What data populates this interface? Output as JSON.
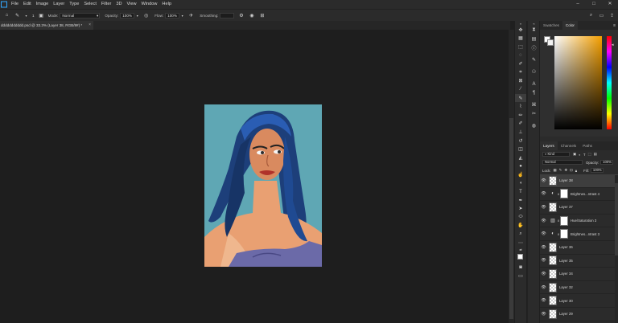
{
  "menu": [
    "File",
    "Edit",
    "Image",
    "Layer",
    "Type",
    "Select",
    "Filter",
    "3D",
    "View",
    "Window",
    "Help"
  ],
  "options": {
    "brush_size": "1",
    "mode_label": "Mode:",
    "mode_value": "Normal",
    "opacity_label": "Opacity:",
    "opacity_value": "100%",
    "flow_label": "Flow:",
    "flow_value": "100%",
    "smoothing_label": "Smoothing:"
  },
  "document_tab": {
    "title": "ddddddddddd.psd @ 33.3% (Layer 38, RGB/8#) *",
    "close": "×"
  },
  "panels": {
    "top_tabs": [
      "Swatches",
      "Color"
    ],
    "layer_tabs": [
      "Layers",
      "Channels",
      "Paths"
    ],
    "kind_label": "Kind",
    "blend_mode": "Normal",
    "opacity_label": "Opacity:",
    "opacity_value": "100%",
    "lock_label": "Lock:",
    "fill_label": "Fill:",
    "fill_value": "100%"
  },
  "layers": [
    {
      "name": "Layer 38",
      "type": "pixel",
      "selected": true
    },
    {
      "name": "Brightnes...ntrast 4",
      "type": "brightness",
      "selected": false
    },
    {
      "name": "Layer 37",
      "type": "pixel",
      "selected": false
    },
    {
      "name": "Hue/Saturation 3",
      "type": "hue",
      "selected": false
    },
    {
      "name": "Brightnes...ntrast 3",
      "type": "brightness",
      "selected": false
    },
    {
      "name": "Layer 36",
      "type": "pixel",
      "selected": false
    },
    {
      "name": "Layer 35",
      "type": "pixel",
      "selected": false
    },
    {
      "name": "Layer 34",
      "type": "pixel",
      "selected": false
    },
    {
      "name": "Layer 32",
      "type": "pixel",
      "selected": false
    },
    {
      "name": "Layer 30",
      "type": "pixel",
      "selected": false
    },
    {
      "name": "Layer 29",
      "type": "pixel",
      "selected": false
    }
  ],
  "colors": {
    "canvas_bg": "#5fa7b4",
    "ui_dark": "#1e1e1e",
    "ui_panel": "#2b2b2b",
    "color_picker_hue": "#f5a000"
  }
}
